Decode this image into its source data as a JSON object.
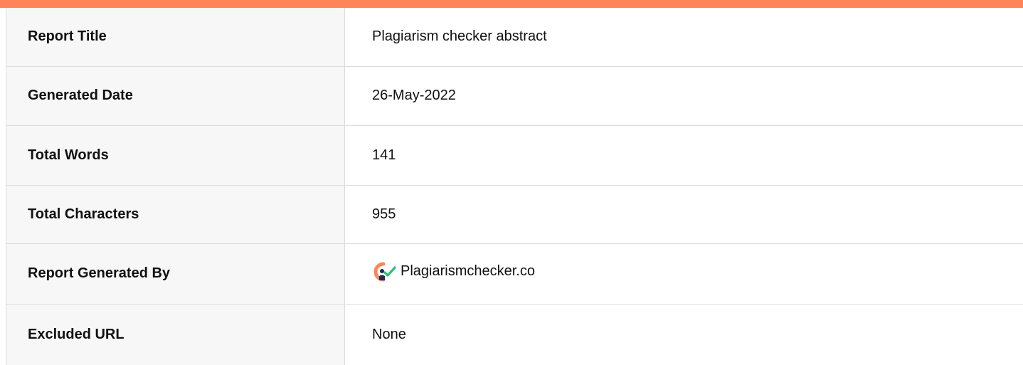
{
  "theme": {
    "accent": "#ff8457",
    "label_bg": "#f7f7f7",
    "border": "#dcdcdc"
  },
  "rows": [
    {
      "label": "Report Title",
      "value": "Plagiarism checker abstract"
    },
    {
      "label": "Generated Date",
      "value": "26-May-2022"
    },
    {
      "label": "Total Words",
      "value": "141"
    },
    {
      "label": "Total Characters",
      "value": "955"
    },
    {
      "label": "Report Generated By",
      "value": "Plagiarismchecker.co",
      "icon": "plagiarismchecker-logo-icon"
    },
    {
      "label": "Excluded URL",
      "value": "None"
    }
  ]
}
